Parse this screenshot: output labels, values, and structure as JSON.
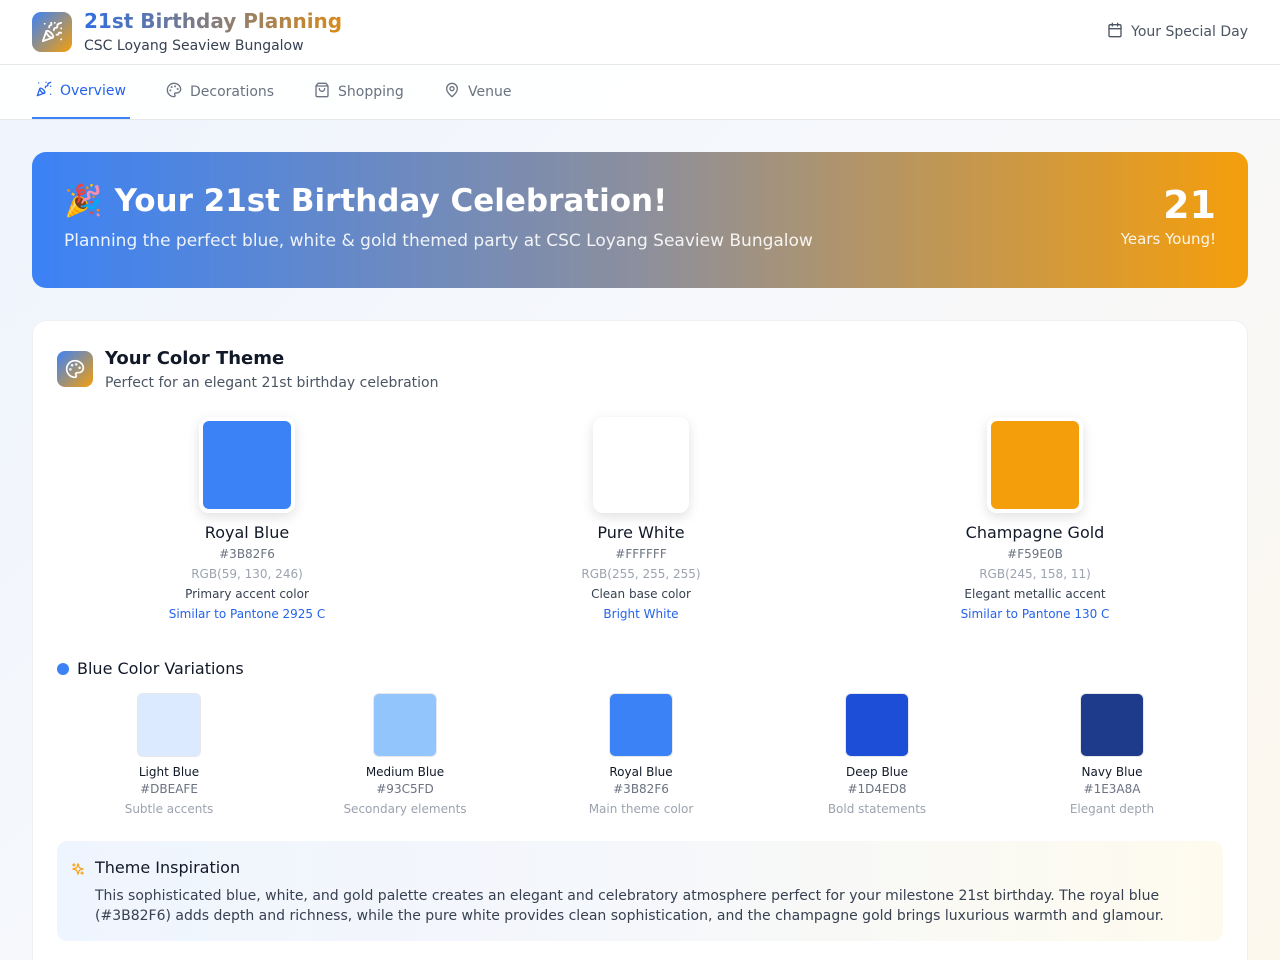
{
  "header": {
    "title": "21st Birthday Planning",
    "subtitle": "CSC Loyang Seaview Bungalow",
    "logo_icon": "party-popper-icon",
    "special_day_label": "Your Special Day",
    "special_day_icon": "calendar-icon"
  },
  "tabs": [
    {
      "label": "Overview",
      "icon": "party-popper-icon",
      "active": true
    },
    {
      "label": "Decorations",
      "icon": "palette-icon",
      "active": false
    },
    {
      "label": "Shopping",
      "icon": "shopping-bag-icon",
      "active": false
    },
    {
      "label": "Venue",
      "icon": "map-pin-icon",
      "active": false
    }
  ],
  "hero": {
    "emoji": "🎉",
    "title": "Your 21st Birthday Celebration!",
    "subtitle": "Planning the perfect blue, white & gold themed party at CSC Loyang Seaview Bungalow",
    "age": "21",
    "age_label": "Years Young!"
  },
  "theme": {
    "title": "Your Color Theme",
    "subtitle": "Perfect for an elegant 21st birthday celebration",
    "colors": [
      {
        "name": "Royal Blue",
        "hex": "#3B82F6",
        "rgb": "RGB(59, 130, 246)",
        "description": "Primary accent color",
        "pantone": "Similar to Pantone 2925 C"
      },
      {
        "name": "Pure White",
        "hex": "#FFFFFF",
        "rgb": "RGB(255, 255, 255)",
        "description": "Clean base color",
        "pantone": "Bright White"
      },
      {
        "name": "Champagne Gold",
        "hex": "#F59E0B",
        "rgb": "RGB(245, 158, 11)",
        "description": "Elegant metallic accent",
        "pantone": "Similar to Pantone 130 C"
      }
    ]
  },
  "variations": {
    "title": "Blue Color Variations",
    "items": [
      {
        "name": "Light Blue",
        "hex": "#DBEAFE",
        "description": "Subtle accents"
      },
      {
        "name": "Medium Blue",
        "hex": "#93C5FD",
        "description": "Secondary elements"
      },
      {
        "name": "Royal Blue",
        "hex": "#3B82F6",
        "description": "Main theme color"
      },
      {
        "name": "Deep Blue",
        "hex": "#1D4ED8",
        "description": "Bold statements"
      },
      {
        "name": "Navy Blue",
        "hex": "#1E3A8A",
        "description": "Elegant depth"
      }
    ]
  },
  "inspiration": {
    "title": "Theme Inspiration",
    "icon": "sparkles-icon",
    "body": "This sophisticated blue, white, and gold palette creates an elegant and celebratory atmosphere perfect for your milestone 21st birthday. The royal blue (#3B82F6) adds depth and richness, while the pure white provides clean sophistication, and the champagne gold brings luxurious warmth and glamour."
  }
}
